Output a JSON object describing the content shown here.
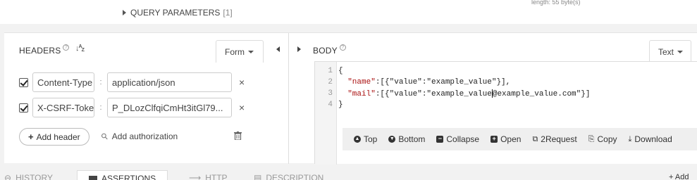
{
  "top": {
    "query_params_label": "QUERY PARAMETERS",
    "query_params_count": "[1]",
    "length_text": "length: 55 byte(s)"
  },
  "headers": {
    "title": "HEADERS",
    "mode_label": "Form",
    "rows": [
      {
        "checked": true,
        "name": "Content-Type",
        "value": "application/json"
      },
      {
        "checked": true,
        "name": "X-CSRF-Token",
        "value": "P_DLozClfqiCmHt3itGl79..."
      }
    ],
    "add_header_label": "Add header",
    "add_auth_label": "Add authorization",
    "help_glyph": "?",
    "sort_glyph": "↓A/Z"
  },
  "body": {
    "title": "BODY",
    "mode_label": "Text",
    "line_numbers": [
      "1",
      "2",
      "3",
      "4"
    ],
    "lines": {
      "l1": "{",
      "l2_key": "\"name\"",
      "l2_rest": ":[{\"value\":\"example_value\"}],",
      "l3_key": "\"mail\"",
      "l3_rest_a": ":[{\"value\":\"example_value",
      "l3_rest_b": "@example_value.com\"}]",
      "l4": "}"
    },
    "toolbar": {
      "top": "Top",
      "bottom": "Bottom",
      "collapse": "Collapse",
      "open": "Open",
      "to_request": "2Request",
      "copy": "Copy",
      "download": "Download"
    }
  },
  "bottom_tabs": {
    "history": "HISTORY",
    "assertions": "ASSERTIONS",
    "http": "HTTP",
    "description": "DESCRIPTION",
    "add": "Add"
  }
}
